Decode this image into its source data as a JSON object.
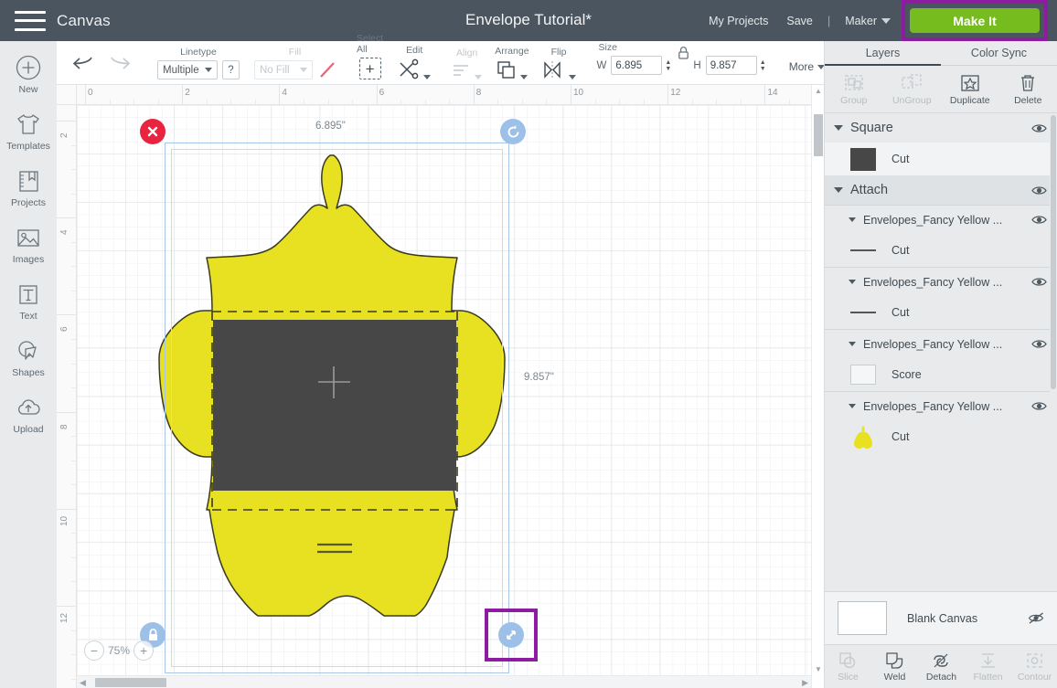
{
  "header": {
    "menu_icon": "hamburger-menu-icon",
    "canvas_label": "Canvas",
    "doc_title": "Envelope Tutorial*",
    "my_projects": "My Projects",
    "save": "Save",
    "divider": "|",
    "machine": "Maker",
    "make_it": "Make It",
    "bg_color": "#4a5560",
    "make_it_color": "#77bc1f",
    "highlight_color": "#8e1ca0"
  },
  "sidebar": {
    "items": [
      {
        "label": "New",
        "icon": "plus-circle-icon"
      },
      {
        "label": "Templates",
        "icon": "tshirt-icon"
      },
      {
        "label": "Projects",
        "icon": "book-bookmark-icon"
      },
      {
        "label": "Images",
        "icon": "picture-icon"
      },
      {
        "label": "Text",
        "icon": "text-t-icon"
      },
      {
        "label": "Shapes",
        "icon": "shapes-icon"
      },
      {
        "label": "Upload",
        "icon": "cloud-upload-icon"
      }
    ]
  },
  "toolbar": {
    "undo": "undo-arrow-icon",
    "redo": "redo-arrow-icon",
    "linetype_label": "Linetype",
    "linetype_value": "Multiple",
    "linetype_help": "?",
    "fill_label": "Fill",
    "fill_value": "No Fill",
    "select_all_label": "Select All",
    "edit_label": "Edit",
    "align_label": "Align",
    "arrange_label": "Arrange",
    "flip_label": "Flip",
    "size_label": "Size",
    "width_label": "W",
    "width_value": "6.895",
    "height_label": "H",
    "height_value": "9.857",
    "lock_icon": "lock-closed-icon",
    "more_label": "More"
  },
  "canvas": {
    "ruler_h_ticks": [
      "0",
      "2",
      "4",
      "6",
      "8",
      "10",
      "12",
      "14"
    ],
    "ruler_v_ticks": [
      "2",
      "4",
      "6",
      "8",
      "10",
      "12"
    ],
    "width_dim_label": "6.895\"",
    "height_dim_label": "9.857\"",
    "zoom_level": "75%",
    "zoom_out": "−",
    "zoom_in": "+",
    "delete_handle": "delete-x-icon",
    "rotate_handle": "rotate-icon",
    "lock_handle": "lock-icon",
    "resize_handle": "resize-diagonal-icon",
    "shape_fill": "#e8e122",
    "square_fill": "#474747",
    "selection_color": "#a9c5e8",
    "highlight_color": "#8e1ca0"
  },
  "right_panel": {
    "tabs": [
      {
        "label": "Layers",
        "active": true
      },
      {
        "label": "Color Sync",
        "active": false
      }
    ],
    "ops": [
      {
        "label": "Group",
        "icon": "group-icon",
        "enabled": false
      },
      {
        "label": "UnGroup",
        "icon": "ungroup-icon",
        "enabled": false
      },
      {
        "label": "Duplicate",
        "icon": "duplicate-icon",
        "enabled": true
      },
      {
        "label": "Delete",
        "icon": "trash-icon",
        "enabled": true
      }
    ],
    "layers": [
      {
        "name": "Square",
        "type": "group",
        "visible": true,
        "children": [
          {
            "label": "Cut",
            "swatch": "square-dark"
          }
        ]
      },
      {
        "name": "Attach",
        "type": "attach",
        "visible": true,
        "sublayers": [
          {
            "name": "Envelopes_Fancy Yellow ...",
            "visible": true,
            "children": [
              {
                "label": "Cut",
                "swatch": "line"
              }
            ]
          },
          {
            "name": "Envelopes_Fancy Yellow ...",
            "visible": true,
            "children": [
              {
                "label": "Cut",
                "swatch": "line"
              }
            ]
          },
          {
            "name": "Envelopes_Fancy Yellow ...",
            "visible": true,
            "children": [
              {
                "label": "Score",
                "swatch": "outline"
              }
            ]
          },
          {
            "name": "Envelopes_Fancy Yellow ...",
            "visible": true,
            "children": [
              {
                "label": "Cut",
                "swatch": "envelope-yellow"
              }
            ]
          }
        ]
      }
    ],
    "canvas_row": {
      "label": "Blank Canvas",
      "visibility_icon": "eye-slash-icon"
    },
    "bottom_ops": [
      {
        "label": "Slice",
        "icon": "slice-icon",
        "enabled": false
      },
      {
        "label": "Weld",
        "icon": "weld-icon",
        "enabled": true
      },
      {
        "label": "Detach",
        "icon": "detach-icon",
        "enabled": true
      },
      {
        "label": "Flatten",
        "icon": "flatten-icon",
        "enabled": false
      },
      {
        "label": "Contour",
        "icon": "contour-icon",
        "enabled": false
      }
    ]
  }
}
